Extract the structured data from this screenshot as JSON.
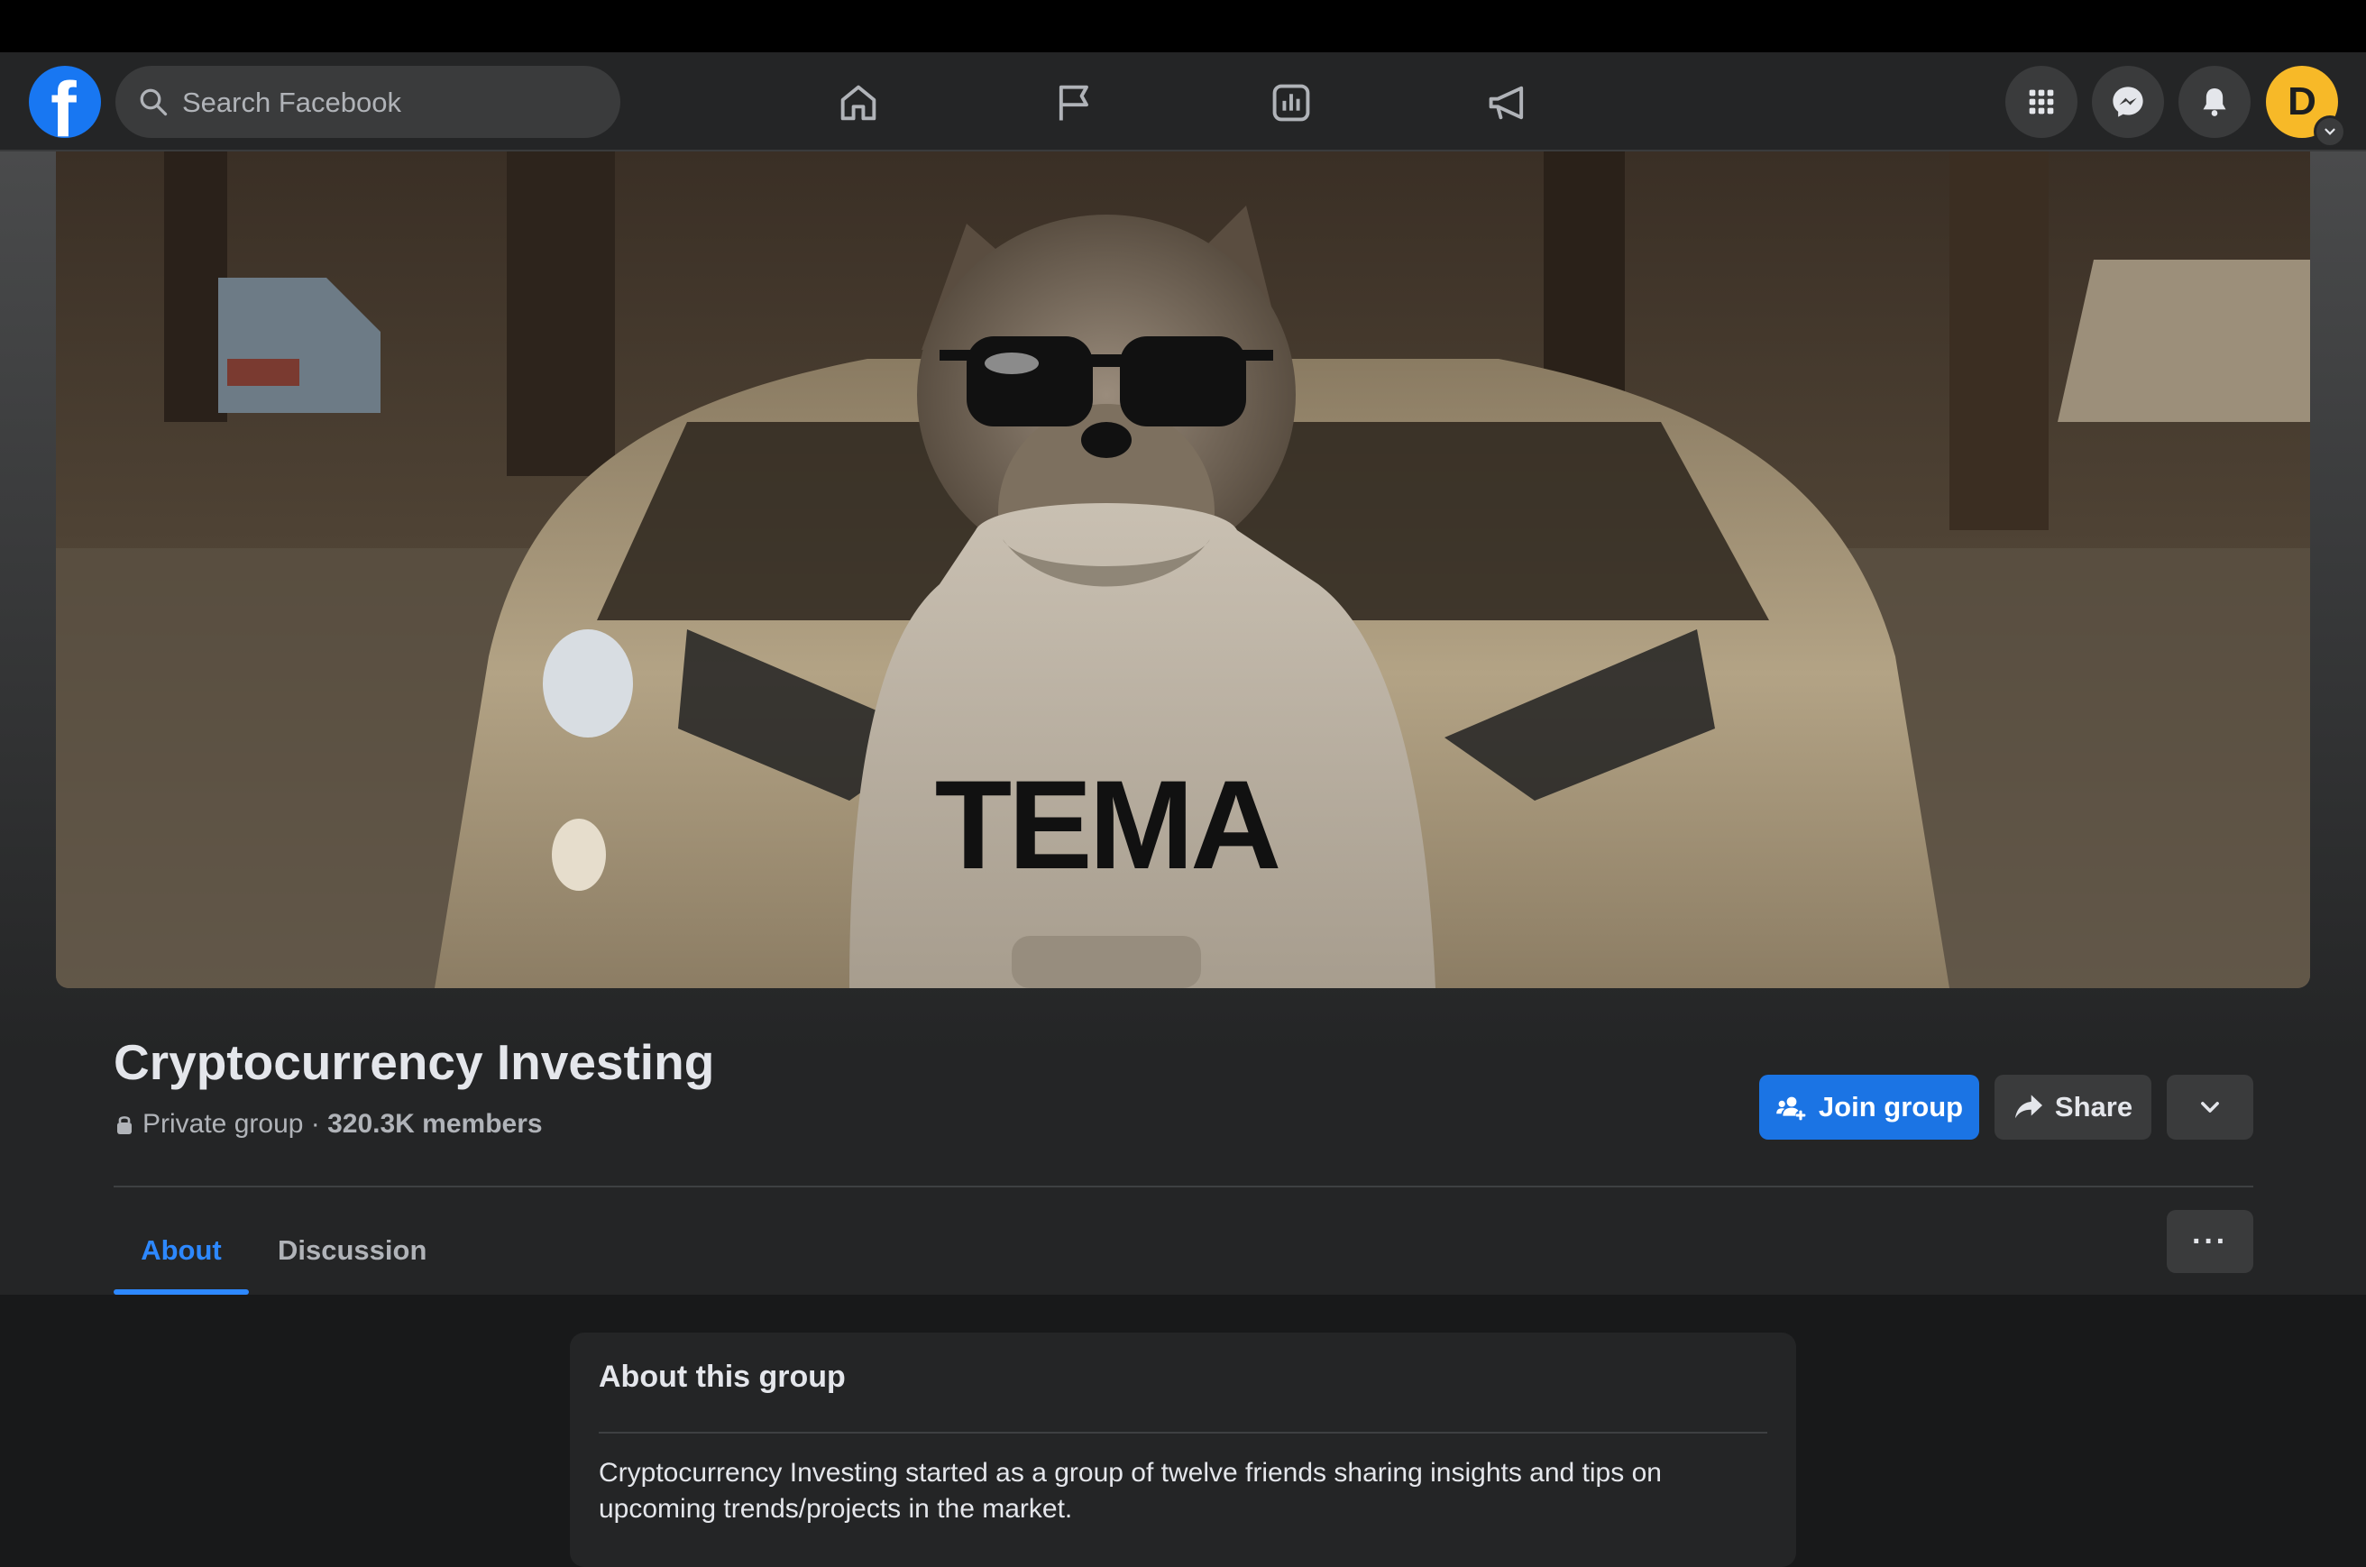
{
  "search": {
    "placeholder": "Search Facebook"
  },
  "nav": {
    "icons": [
      "home-icon",
      "flag-icon",
      "chart-icon",
      "megaphone-icon"
    ]
  },
  "header_right": {
    "icons": [
      "grid-menu-icon",
      "messenger-icon",
      "bell-icon"
    ],
    "avatar_initial": "D"
  },
  "cover": {
    "hoodie_text": "TEMA"
  },
  "group": {
    "title": "Cryptocurrency Investing",
    "privacy": "Private group",
    "separator": " · ",
    "members": "320.3K members"
  },
  "actions": {
    "join_label": "Join group",
    "share_label": "Share"
  },
  "tabs": [
    {
      "label": "About",
      "active": true
    },
    {
      "label": "Discussion",
      "active": false
    }
  ],
  "more_label": "···",
  "about": {
    "title": "About this group",
    "text": "Cryptocurrency Investing started as a group of twelve friends sharing insights and tips on upcoming trends/projects in the market."
  },
  "colors": {
    "brand": "#1877f2",
    "accent": "#2d88ff",
    "background": "#18191a",
    "surface": "#242526"
  }
}
